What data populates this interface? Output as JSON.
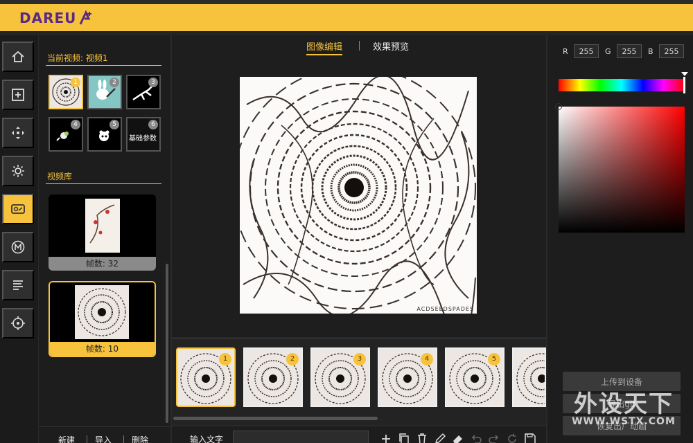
{
  "app": {
    "logo": "DAREU"
  },
  "nav": [
    "home-icon",
    "add-box-icon",
    "move-icon",
    "sun-icon",
    "video-icon",
    "m-circle-icon",
    "text-lines-icon",
    "crosshair-icon"
  ],
  "current": {
    "title": "当前视频: 视频1",
    "items": [
      {
        "num": "1",
        "text": ""
      },
      {
        "num": "2",
        "text": ""
      },
      {
        "num": "3",
        "text": ""
      },
      {
        "num": "4",
        "text": ""
      },
      {
        "num": "5",
        "text": ""
      },
      {
        "num": "6",
        "text": "基础参数"
      }
    ]
  },
  "library": {
    "title": "视频库",
    "items": [
      {
        "caption": "帧数: 32"
      },
      {
        "caption": "帧数: 10"
      }
    ]
  },
  "left_actions": {
    "new": "新建",
    "import": "导入",
    "delete": "删除"
  },
  "tabs": {
    "edit": "图像编辑",
    "preview": "效果预览"
  },
  "canvas": {
    "watermark_text": "ACDSEEDSPADES"
  },
  "frames": [
    "1",
    "2",
    "3",
    "4",
    "5"
  ],
  "toolbar": {
    "input_label": "输入文字",
    "input_value": ""
  },
  "color": {
    "r_label": "R",
    "g_label": "G",
    "b_label": "B",
    "r": "255",
    "g": "255",
    "b": "255",
    "accent": "#f7c23c"
  },
  "right_actions": {
    "upload": "上传到设备",
    "export": "导出gif",
    "restore": "恢复出厂动画"
  },
  "watermark": {
    "big": "外设天下",
    "small": "WWW.WSTX.COM"
  }
}
